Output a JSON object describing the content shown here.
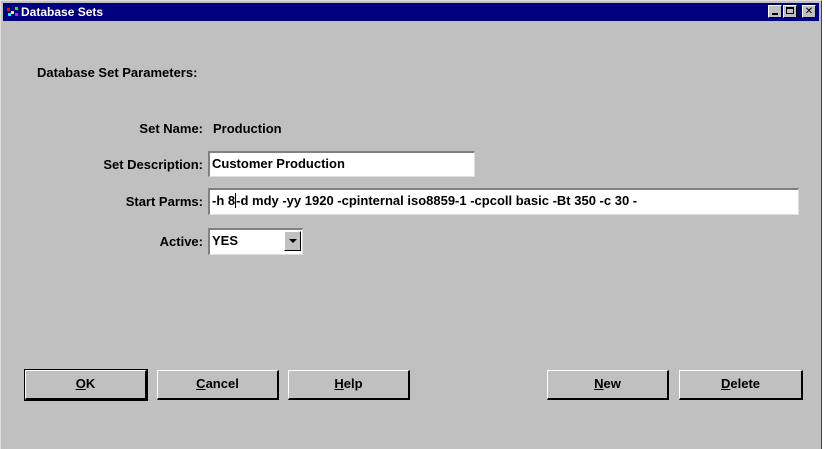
{
  "window": {
    "title": "Database Sets",
    "icon": "database-sets-icon"
  },
  "form": {
    "section_heading": "Database Set Parameters:",
    "set_name": {
      "label": "Set Name:",
      "value": "Production"
    },
    "set_description": {
      "label": "Set Description:",
      "value": "Customer Production"
    },
    "start_parms": {
      "label": "Start Parms:",
      "value_before_caret": "-h 8",
      "value_after_caret": "-d mdy -yy 1920 -cpinternal iso8859-1 -cpcoll basic -Bt 350 -c 30 -"
    },
    "active": {
      "label": "Active:",
      "value": "YES"
    }
  },
  "buttons": {
    "ok": {
      "mnemonic": "O",
      "rest": "K"
    },
    "cancel": {
      "mnemonic": "C",
      "rest": "ancel"
    },
    "help": {
      "mnemonic": "H",
      "rest": "elp"
    },
    "new": {
      "mnemonic": "N",
      "rest": "ew"
    },
    "delete": {
      "mnemonic": "D",
      "rest": "elete"
    }
  },
  "colors": {
    "titlebar": "#000080",
    "face": "#c0c0c0"
  }
}
